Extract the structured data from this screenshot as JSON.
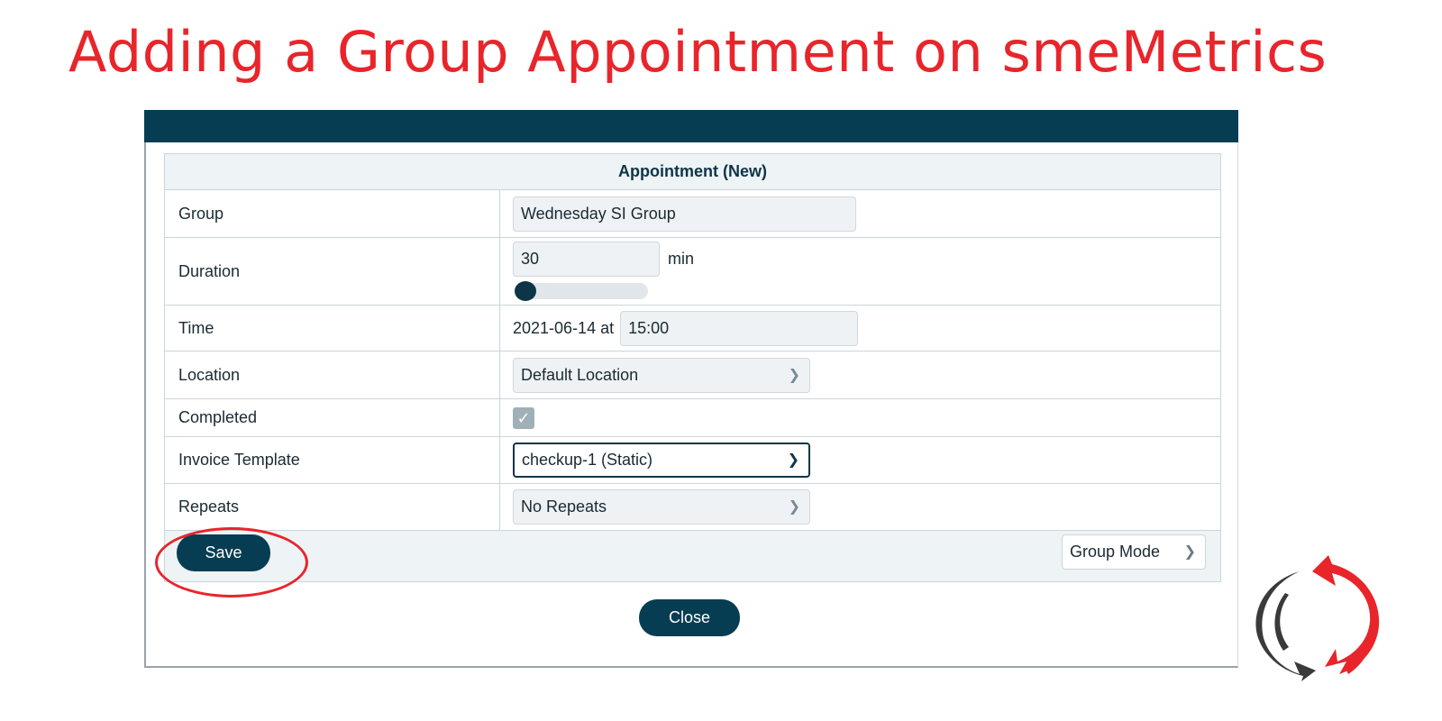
{
  "slide": {
    "title": "Adding a Group Appointment on smeMetrics"
  },
  "dialog": {
    "header": "Appointment (New)",
    "rows": {
      "group": {
        "label": "Group",
        "value": "Wednesday SI Group"
      },
      "duration": {
        "label": "Duration",
        "value": "30",
        "unit": "min",
        "slider_level": 0
      },
      "time": {
        "label": "Time",
        "date_prefix": "2021-06-14 at",
        "value": "15:00"
      },
      "location": {
        "label": "Location",
        "selected": "Default Location"
      },
      "completed": {
        "label": "Completed",
        "checked": true
      },
      "invoice_template": {
        "label": "Invoice Template",
        "selected": "checkup-1 (Static)"
      },
      "repeats": {
        "label": "Repeats",
        "selected": "No Repeats"
      }
    },
    "save_label": "Save",
    "group_mode_label": "Group Mode",
    "close_label": "Close"
  },
  "colors": {
    "title_red": "#e8252b",
    "dialog_header_navy": "#073d52",
    "button_navy": "#073d52",
    "highlight_circle": "#e8252b"
  },
  "icons": {
    "dropdown": "chevron-down-icon",
    "checkbox": "check-icon",
    "logo": "brand-logo-icon"
  }
}
